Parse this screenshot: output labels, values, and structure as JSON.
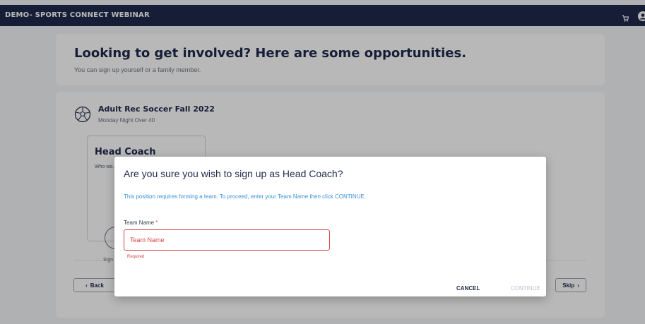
{
  "app": {
    "title": "DEMO- SPORTS CONNECT WEBINAR"
  },
  "header": {
    "cart_icon": "cart-icon",
    "profile_icon": "user-circle-icon"
  },
  "intro": {
    "heading": "Looking to get involved? Here are some opportunities.",
    "subheading": "You can sign up yourself or a family member."
  },
  "program": {
    "icon": "soccer-ball-icon",
    "title": "Adult Rec Soccer Fall 2022",
    "subtitle": "Monday Night Over 40",
    "role": {
      "title": "Head Coach",
      "description": "Who wo... role?",
      "sign_label": "Sign"
    }
  },
  "nav": {
    "back_label": "Back",
    "skip_label": "Skip"
  },
  "dialog": {
    "title": "Are you sure you wish to sign up as Head Coach?",
    "info": "This position requires forming a team. To proceed, enter your Team Name then click CONTINUE.",
    "field_label": "Team Name",
    "required_mark": "*",
    "input_placeholder": "Team Name",
    "input_value": "",
    "helper_text": "Required",
    "cancel_label": "CANCEL",
    "continue_label": "CONTINUE"
  },
  "colors": {
    "navy": "#1e2a4c",
    "info_blue": "#3a8fd8",
    "error_red": "#d64545",
    "disabled": "#b8c1cc"
  }
}
